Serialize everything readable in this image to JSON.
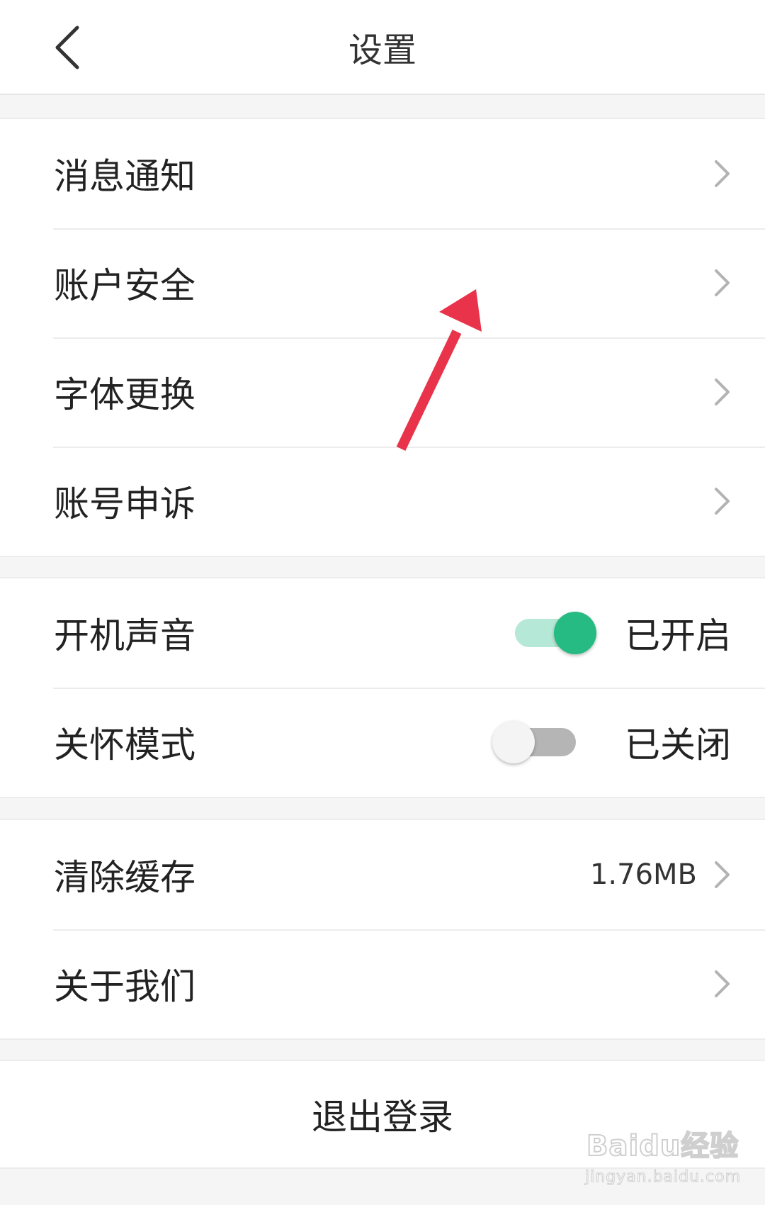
{
  "header": {
    "title": "设置"
  },
  "groups": [
    {
      "items": [
        {
          "label": "消息通知"
        },
        {
          "label": "账户安全"
        },
        {
          "label": "字体更换"
        },
        {
          "label": "账号申诉"
        }
      ]
    },
    {
      "items": [
        {
          "label": "开机声音",
          "switch_on": true,
          "status": "已开启"
        },
        {
          "label": "关怀模式",
          "switch_on": false,
          "status": "已关闭"
        }
      ]
    },
    {
      "items": [
        {
          "label": "清除缓存",
          "value": "1.76MB"
        },
        {
          "label": "关于我们"
        }
      ]
    }
  ],
  "logout_label": "退出登录",
  "watermark": {
    "logo": "Baidu经验",
    "url": "jingyan.baidu.com"
  },
  "colors": {
    "switch_on_thumb": "#25bb83",
    "switch_on_track": "#b5e8d6",
    "switch_off_track": "#b5b5b5",
    "annotation_arrow": "#e8334a"
  },
  "icons": {
    "back": "chevron-left-icon",
    "row_arrow": "chevron-right-icon"
  }
}
